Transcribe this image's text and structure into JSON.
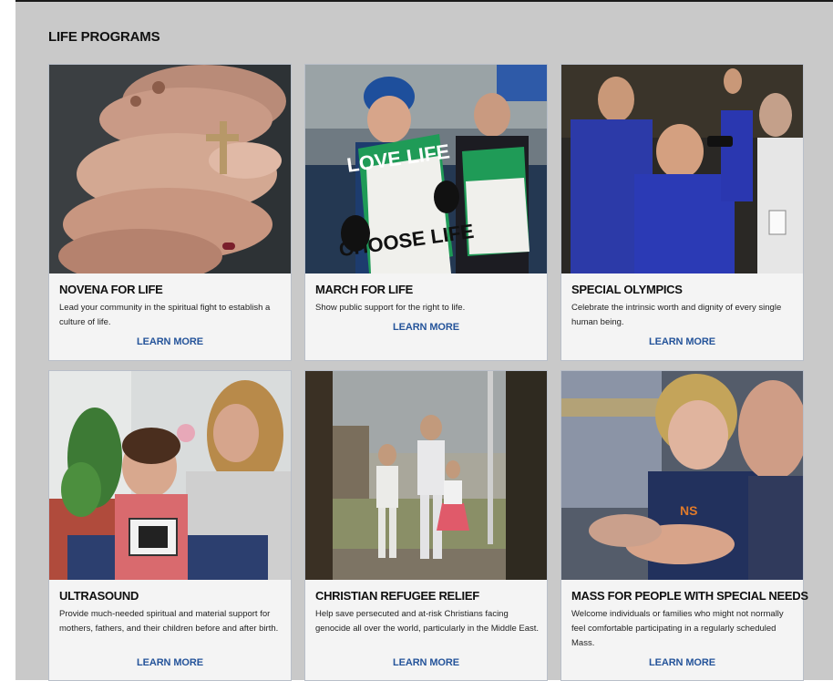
{
  "section": {
    "title": "LIFE PROGRAMS"
  },
  "cards": [
    {
      "title": "NOVENA FOR LIFE",
      "description": "Lead your community in the spiritual fight to establish a culture of life.",
      "link": "LEARN MORE"
    },
    {
      "title": "MARCH FOR LIFE",
      "description": "Show public support for the right to life.",
      "link": "LEARN MORE"
    },
    {
      "title": "SPECIAL OLYMPICS",
      "description": "Celebrate the intrinsic worth and dignity of every single human being.",
      "link": "LEARN MORE"
    },
    {
      "title": "ULTRASOUND",
      "description": "Provide much-needed spiritual and material support for mothers, fathers, and their children before and after birth.",
      "link": "LEARN MORE"
    },
    {
      "title": "CHRISTIAN REFUGEE RELIEF",
      "description": "Help save persecuted and at-risk Christians facing genocide all over the world, particularly in the Middle East.",
      "link": "LEARN MORE"
    },
    {
      "title": "MASS FOR PEOPLE WITH SPECIAL NEEDS",
      "description": "Welcome individuals or families who might not normally feel comfortable participating in a regularly scheduled Mass.",
      "link": "LEARN MORE"
    }
  ],
  "signs": {
    "line1": "LOVE LIFE",
    "line2": "CHOOSE LIFE"
  },
  "colors": {
    "link": "#25549a",
    "background": "#c9c9c9",
    "card": "#f4f4f4"
  }
}
